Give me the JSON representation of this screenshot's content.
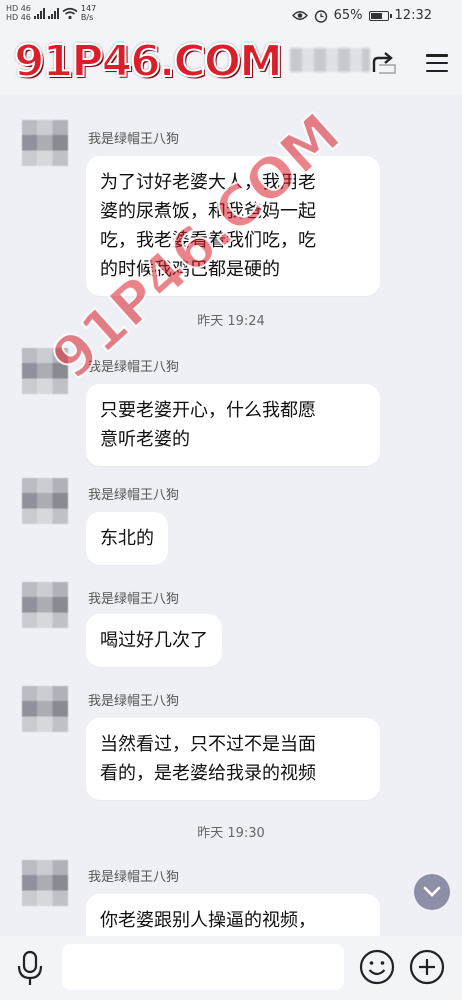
{
  "status_bar": {
    "network_top": "HD 46",
    "network_bottom": "HD 46",
    "speed_value": "147",
    "speed_unit": "B/s",
    "battery": "65%",
    "time": "12:32"
  },
  "header": {
    "watermark": "91P46.COM"
  },
  "chat": {
    "messages": [
      {
        "sender": "我是绿帽王八狗",
        "lines": [
          "为了讨好老婆大人，我用老",
          "婆的尿煮饭，和我爸妈一起",
          "吃，我老婆看着我们吃，吃",
          "的时候我鸡巴都是硬的"
        ]
      },
      {
        "sender": "我是绿帽王八狗",
        "lines": [
          "只要老婆开心，什么我都愿",
          "意听老婆的"
        ]
      },
      {
        "sender": "我是绿帽王八狗",
        "lines": [
          "东北的"
        ]
      },
      {
        "sender": "我是绿帽王八狗",
        "lines": [
          "喝过好几次了"
        ]
      },
      {
        "sender": "我是绿帽王八狗",
        "lines": [
          "当然看过，只不过不是当面",
          "看的，是老婆给我录的视频"
        ]
      },
      {
        "sender": "我是绿帽王八狗",
        "lines": [
          "你老婆跟别人操逼的视频，"
        ]
      }
    ],
    "timestamps": [
      "昨天 19:24",
      "昨天 19:30"
    ],
    "diagonal_watermark": "91P46.COM"
  },
  "colors": {
    "background": "#eef0f5",
    "bubble": "#ffffff",
    "watermark": "#d81f2a",
    "scroll_button": "#8d8fa6"
  },
  "icons": [
    "eye-icon",
    "alarm-icon",
    "battery-icon",
    "share-icon",
    "menu-icon",
    "chevron-down-icon",
    "microphone-icon",
    "emoji-icon",
    "plus-icon"
  ]
}
